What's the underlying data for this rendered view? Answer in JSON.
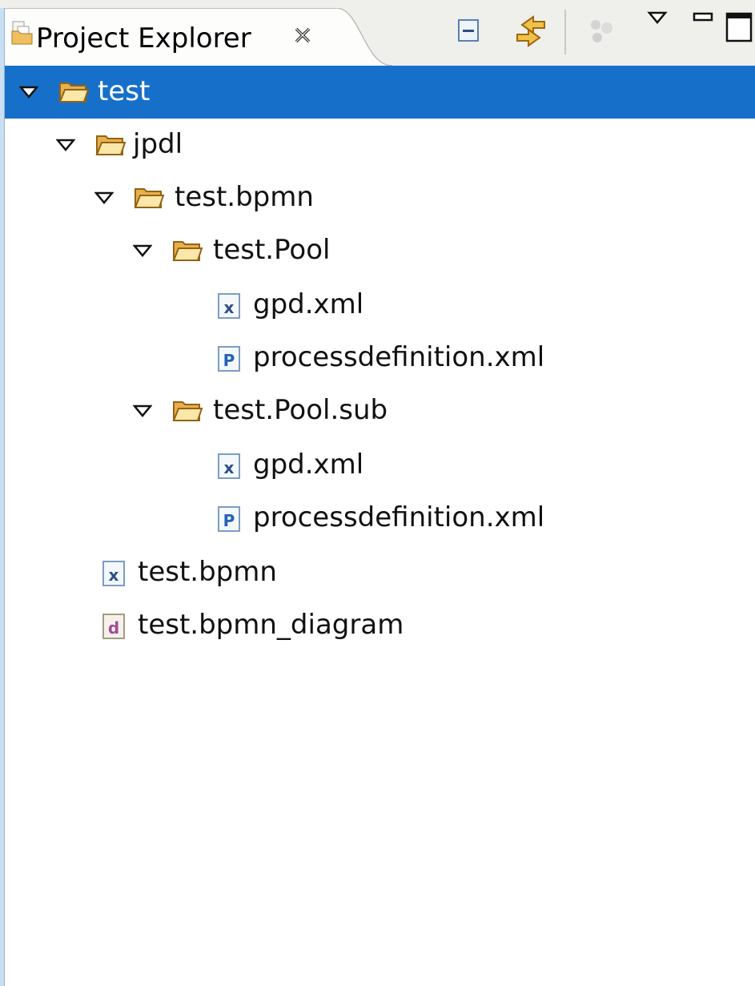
{
  "view": {
    "tab_title": "Project Explorer",
    "tab_icon": "project-explorer-icon",
    "toolbar": {
      "collapse_all": "collapse-all-icon",
      "link_with_editor": "link-with-editor-icon",
      "filter": "filter-icon",
      "view_menu": "view-menu-icon",
      "minimize": "minimize-icon",
      "maximize": "maximize-icon"
    }
  },
  "tree": {
    "items": [
      {
        "label": "test",
        "type": "folder",
        "expanded": true,
        "selected": true
      },
      {
        "label": "jpdl",
        "type": "folder",
        "expanded": true
      },
      {
        "label": "test.bpmn",
        "type": "folder",
        "expanded": true
      },
      {
        "label": "test.Pool",
        "type": "folder",
        "expanded": true
      },
      {
        "label": "gpd.xml",
        "type": "xml-file"
      },
      {
        "label": "processdefinition.xml",
        "type": "process-file"
      },
      {
        "label": "test.Pool.sub",
        "type": "folder",
        "expanded": true
      },
      {
        "label": "gpd.xml",
        "type": "xml-file"
      },
      {
        "label": "processdefinition.xml",
        "type": "process-file"
      },
      {
        "label": "test.bpmn",
        "type": "xml-file"
      },
      {
        "label": "test.bpmn_diagram",
        "type": "diagram-file"
      }
    ]
  },
  "colors": {
    "selection": "#1670c9",
    "folder": "#e8b04c",
    "border": "#8eb4dc"
  }
}
